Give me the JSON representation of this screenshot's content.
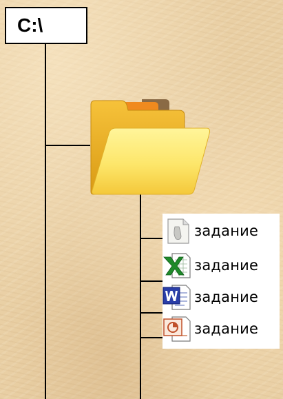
{
  "drive": {
    "label": "C:\\"
  },
  "files": [
    {
      "icon": "text-document-icon",
      "name": "задание"
    },
    {
      "icon": "excel-document-icon",
      "name": "задание"
    },
    {
      "icon": "word-document-icon",
      "name": "задание"
    },
    {
      "icon": "powerpoint-document-icon",
      "name": "задание"
    }
  ]
}
